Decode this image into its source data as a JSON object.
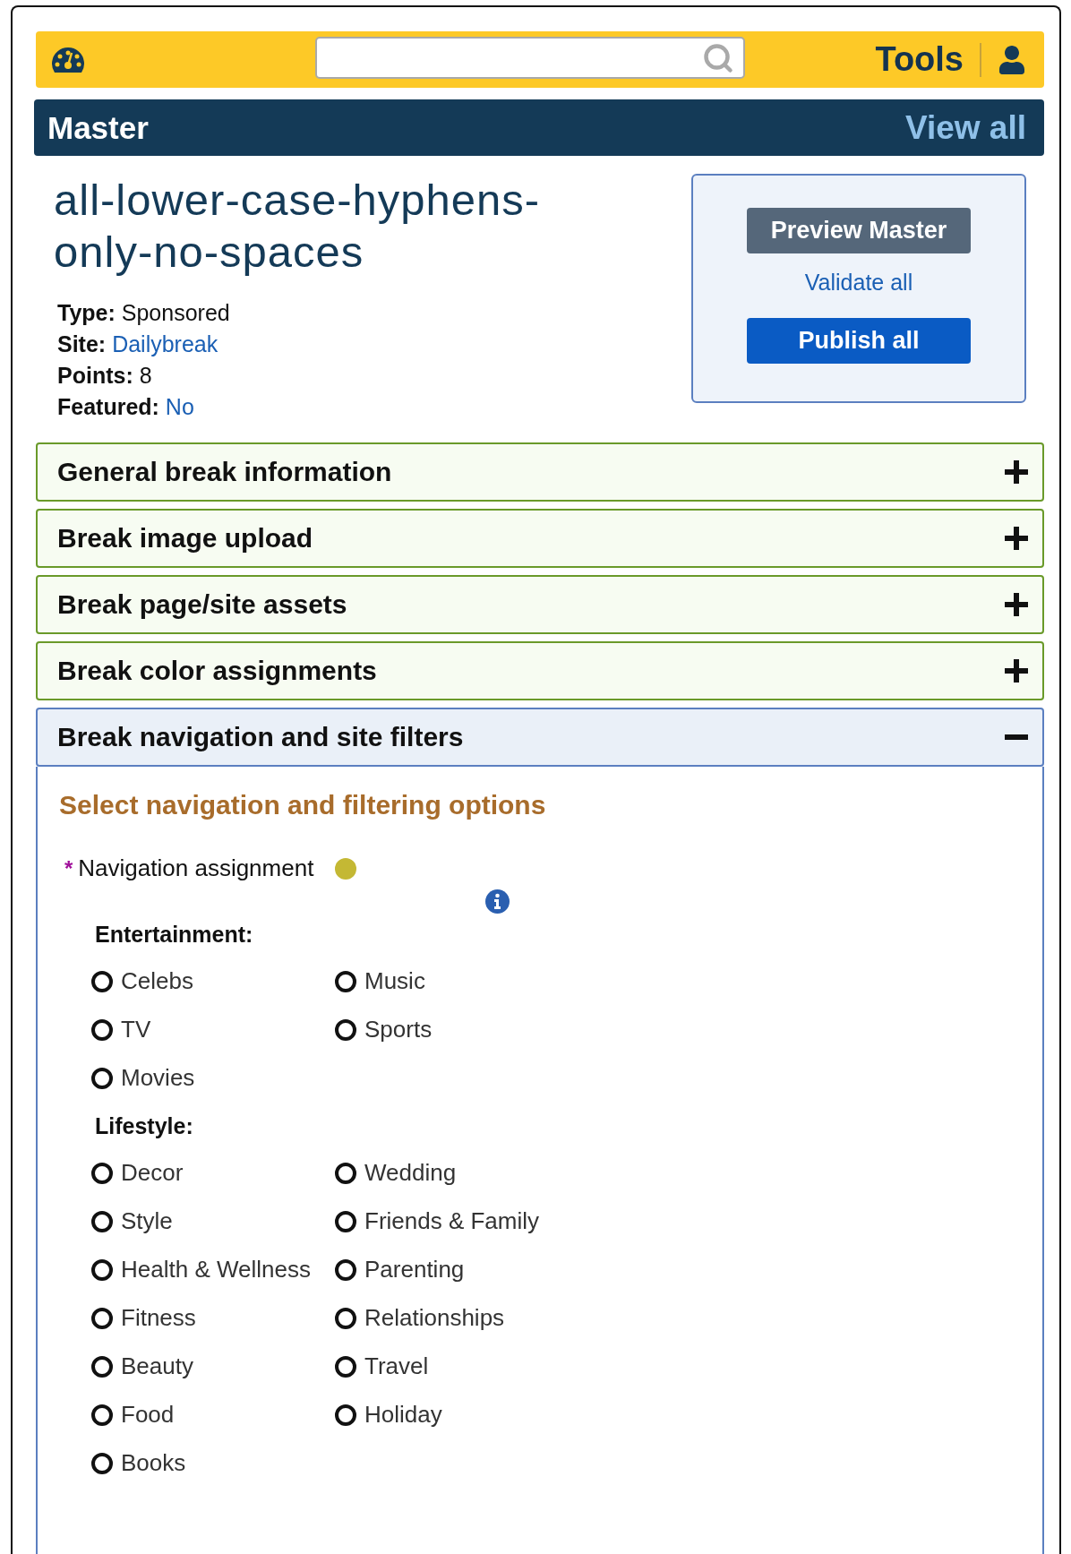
{
  "topbar": {
    "tools_label": "Tools"
  },
  "section_bar": {
    "title": "Master",
    "link": "View all"
  },
  "item": {
    "title_lines": [
      "all-lower-case-hyphens-",
      "only-no-spaces"
    ],
    "meta": [
      {
        "label": "Type:",
        "value": "Sponsored",
        "kind": "text"
      },
      {
        "label": "Site:",
        "value": "Dailybreak",
        "kind": "link"
      },
      {
        "label": "Points:",
        "value": "8",
        "kind": "text"
      },
      {
        "label": "Featured:",
        "value": "No",
        "kind": "link"
      }
    ]
  },
  "actions": {
    "preview": "Preview Master",
    "validate": "Validate all",
    "publish": "Publish all"
  },
  "accordions": [
    {
      "title": "General break information",
      "expanded": false
    },
    {
      "title": "Break image upload",
      "expanded": false
    },
    {
      "title": "Break page/site assets",
      "expanded": false
    },
    {
      "title": "Break color assignments",
      "expanded": false
    },
    {
      "title": "Break navigation and site filters",
      "expanded": true
    }
  ],
  "panel": {
    "heading": "Select navigation and filtering options",
    "required_mark": "*",
    "field_label": "Navigation assignment",
    "groups": [
      {
        "title": "Entertainment:",
        "options": [
          {
            "label": "Celebs",
            "selected": false
          },
          {
            "label": "Music",
            "selected": false
          },
          {
            "label": "TV",
            "selected": false
          },
          {
            "label": "Sports",
            "selected": false
          },
          {
            "label": "Movies",
            "selected": false
          }
        ]
      },
      {
        "title": "Lifestyle:",
        "options": [
          {
            "label": "Decor",
            "selected": false
          },
          {
            "label": "Wedding",
            "selected": false
          },
          {
            "label": "Style",
            "selected": false
          },
          {
            "label": "Friends & Family",
            "selected": false
          },
          {
            "label": "Health & Wellness",
            "selected": false
          },
          {
            "label": "Parenting",
            "selected": false
          },
          {
            "label": "Fitness",
            "selected": false
          },
          {
            "label": "Relationships",
            "selected": false
          },
          {
            "label": "Beauty",
            "selected": false
          },
          {
            "label": "Travel",
            "selected": false
          },
          {
            "label": "Food",
            "selected": false
          },
          {
            "label": "Holiday",
            "selected": false
          },
          {
            "label": "Books",
            "selected": false
          }
        ]
      }
    ]
  }
}
